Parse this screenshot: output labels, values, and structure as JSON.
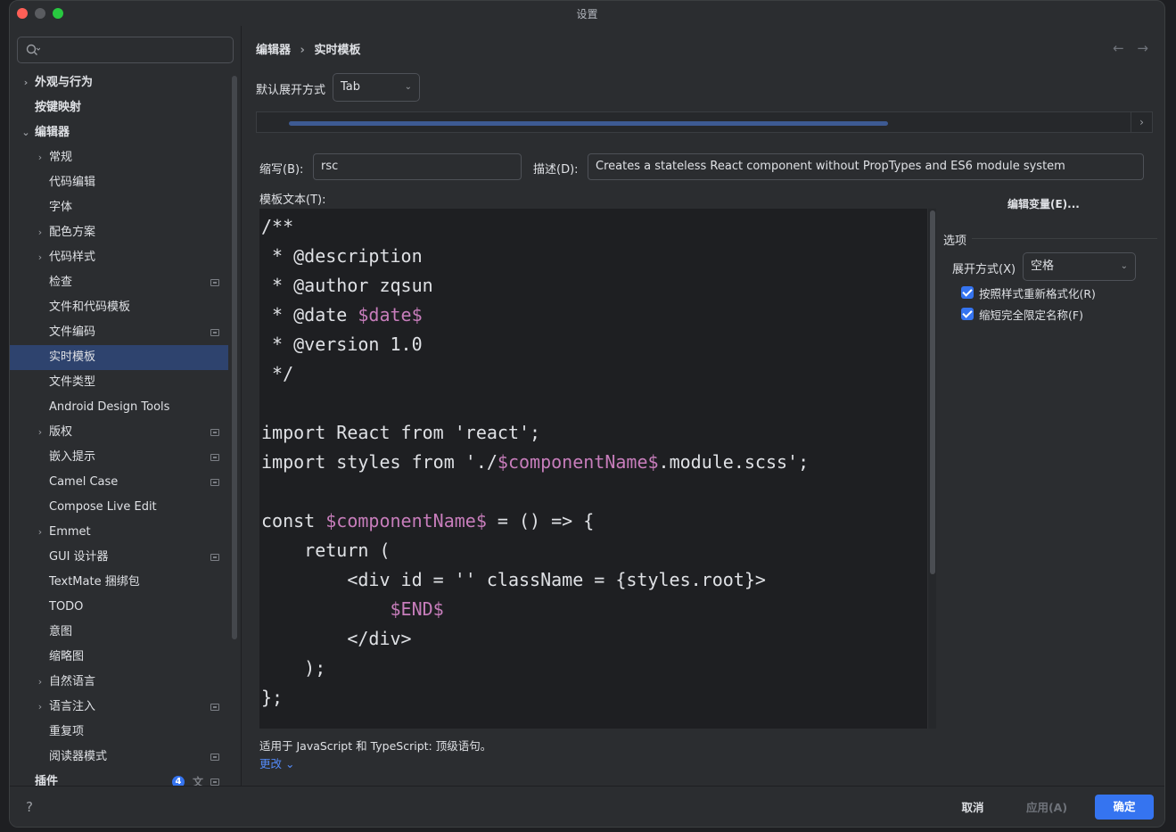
{
  "window": {
    "title": "设置"
  },
  "sidebar": {
    "search_placeholder": "",
    "items": [
      {
        "label": "外观与行为",
        "level": 0,
        "chevron": "right",
        "bold": true,
        "badge": false
      },
      {
        "label": "按键映射",
        "level": 0,
        "chevron": "none",
        "bold": true,
        "badge": false
      },
      {
        "label": "编辑器",
        "level": 0,
        "chevron": "down",
        "bold": true,
        "badge": false
      },
      {
        "label": "常规",
        "level": 1,
        "chevron": "right",
        "bold": false,
        "badge": false
      },
      {
        "label": "代码编辑",
        "level": 1,
        "chevron": "none",
        "bold": false,
        "badge": false
      },
      {
        "label": "字体",
        "level": 1,
        "chevron": "none",
        "bold": false,
        "badge": false
      },
      {
        "label": "配色方案",
        "level": 1,
        "chevron": "right",
        "bold": false,
        "badge": false
      },
      {
        "label": "代码样式",
        "level": 1,
        "chevron": "right",
        "bold": false,
        "badge": false
      },
      {
        "label": "检查",
        "level": 1,
        "chevron": "none",
        "bold": false,
        "badge": true
      },
      {
        "label": "文件和代码模板",
        "level": 1,
        "chevron": "none",
        "bold": false,
        "badge": false
      },
      {
        "label": "文件编码",
        "level": 1,
        "chevron": "none",
        "bold": false,
        "badge": true
      },
      {
        "label": "实时模板",
        "level": 1,
        "chevron": "none",
        "bold": false,
        "badge": false,
        "selected": true
      },
      {
        "label": "文件类型",
        "level": 1,
        "chevron": "none",
        "bold": false,
        "badge": false
      },
      {
        "label": "Android Design Tools",
        "level": 1,
        "chevron": "none",
        "bold": false,
        "badge": false
      },
      {
        "label": "版权",
        "level": 1,
        "chevron": "right",
        "bold": false,
        "badge": true
      },
      {
        "label": "嵌入提示",
        "level": 1,
        "chevron": "none",
        "bold": false,
        "badge": true
      },
      {
        "label": "Camel Case",
        "level": 1,
        "chevron": "none",
        "bold": false,
        "badge": true
      },
      {
        "label": "Compose Live Edit",
        "level": 1,
        "chevron": "none",
        "bold": false,
        "badge": false
      },
      {
        "label": "Emmet",
        "level": 1,
        "chevron": "right",
        "bold": false,
        "badge": false
      },
      {
        "label": "GUI 设计器",
        "level": 1,
        "chevron": "none",
        "bold": false,
        "badge": true
      },
      {
        "label": "TextMate 捆绑包",
        "level": 1,
        "chevron": "none",
        "bold": false,
        "badge": false
      },
      {
        "label": "TODO",
        "level": 1,
        "chevron": "none",
        "bold": false,
        "badge": false
      },
      {
        "label": "意图",
        "level": 1,
        "chevron": "none",
        "bold": false,
        "badge": false
      },
      {
        "label": "缩略图",
        "level": 1,
        "chevron": "none",
        "bold": false,
        "badge": false
      },
      {
        "label": "自然语言",
        "level": 1,
        "chevron": "right",
        "bold": false,
        "badge": false
      },
      {
        "label": "语言注入",
        "level": 1,
        "chevron": "right",
        "bold": false,
        "badge": true
      },
      {
        "label": "重复项",
        "level": 1,
        "chevron": "none",
        "bold": false,
        "badge": false
      },
      {
        "label": "阅读器模式",
        "level": 1,
        "chevron": "none",
        "bold": false,
        "badge": true
      },
      {
        "label": "插件",
        "level": 0,
        "chevron": "none",
        "bold": true,
        "badge": true,
        "count": "4"
      }
    ]
  },
  "breadcrumb": {
    "parent": "编辑器",
    "separator": "›",
    "current": "实时模板"
  },
  "nav": {
    "back": "←",
    "forward": "→"
  },
  "expand_default": {
    "label": "默认展开方式",
    "value": "Tab"
  },
  "abbreviation": {
    "label": "缩写(B):",
    "value": "rsc"
  },
  "description": {
    "label": "描述(D):",
    "value": "Creates a stateless React component without PropTypes and ES6 module system"
  },
  "template_text": {
    "label": "模板文本(T):",
    "lines": [
      [
        {
          "t": "/**"
        }
      ],
      [
        {
          "t": " * @description"
        }
      ],
      [
        {
          "t": " * @author zqsun"
        }
      ],
      [
        {
          "t": " * @date "
        },
        {
          "t": "$date$",
          "v": true
        }
      ],
      [
        {
          "t": " * @version 1.0"
        }
      ],
      [
        {
          "t": " */"
        }
      ],
      [
        {
          "t": ""
        }
      ],
      [
        {
          "t": "import React from 'react';"
        }
      ],
      [
        {
          "t": "import styles from './"
        },
        {
          "t": "$componentName$",
          "v": true
        },
        {
          "t": ".module.scss';"
        }
      ],
      [
        {
          "t": ""
        }
      ],
      [
        {
          "t": "const "
        },
        {
          "t": "$componentName$",
          "v": true
        },
        {
          "t": " = () => {"
        }
      ],
      [
        {
          "t": "    return ("
        }
      ],
      [
        {
          "t": "        <div id = '' className = {styles.root}>"
        }
      ],
      [
        {
          "t": "            "
        },
        {
          "t": "$END$",
          "v": true
        }
      ],
      [
        {
          "t": "        </div>"
        }
      ],
      [
        {
          "t": "    );"
        }
      ],
      [
        {
          "t": "};"
        }
      ]
    ]
  },
  "edit_variables": {
    "label": "编辑变量(E)..."
  },
  "options": {
    "title": "选项",
    "expand_with": {
      "label": "展开方式(X)",
      "value": "空格"
    },
    "reformat": {
      "label": "按照样式重新格式化(R)",
      "checked": true
    },
    "shorten_fq": {
      "label": "缩短完全限定名称(F)",
      "checked": true
    }
  },
  "applicable": {
    "text": "适用于 JavaScript 和 TypeScript: 顶级语句。",
    "change_link": "更改 ⌄"
  },
  "footer": {
    "help": "?",
    "cancel": "取消",
    "apply": "应用(A)",
    "ok": "确定"
  },
  "colors": {
    "accent": "#3574f0",
    "selected_row": "#2e436e",
    "template_var": "#c77dbb",
    "link": "#548af7"
  }
}
